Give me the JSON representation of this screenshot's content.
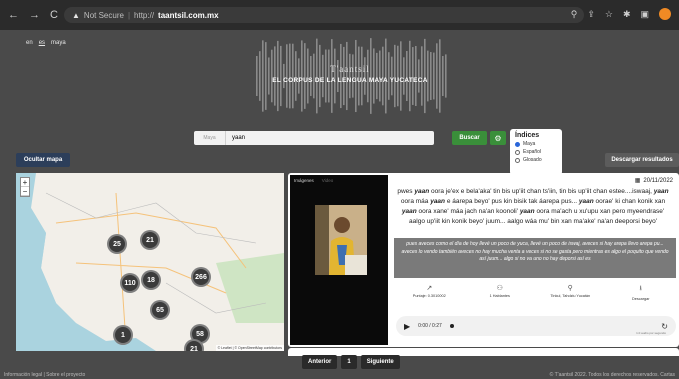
{
  "browser": {
    "security": "Not Secure",
    "url_prefix": "http://",
    "url_host": "taantsil.com.mx",
    "nav": {
      "back": "←",
      "forward": "→",
      "reload": "C"
    }
  },
  "lang": {
    "items": [
      "en",
      "es",
      "maya"
    ]
  },
  "hero": {
    "brand": "T'aantsil",
    "subtitle": "EL CORPUS DE LA LENGUA MAYA YUCATECA"
  },
  "search": {
    "prefix": "Maya",
    "query": "yaan",
    "button": "Buscar"
  },
  "indices": {
    "title": "Índices",
    "options": [
      "Maya",
      "Español",
      "Glosado"
    ],
    "selected": "Maya"
  },
  "toolbar": {
    "hide_map": "Ocultar mapa",
    "download": "Descargar resultados"
  },
  "map": {
    "clusters": [
      {
        "count": "25"
      },
      {
        "count": "21"
      },
      {
        "count": "110"
      },
      {
        "count": "18"
      },
      {
        "count": "266"
      },
      {
        "count": "65"
      },
      {
        "count": "1"
      },
      {
        "count": "58"
      },
      {
        "count": "21"
      }
    ],
    "attribution": "© Leaflet | © OpenStreetMap contributors"
  },
  "result": {
    "media_tabs": [
      "Imágenes",
      "Video"
    ],
    "date": "20/11/2022",
    "transcript_parts": [
      "pwes ",
      "yaan",
      " oora je'ex e bela'aka' tin bis up'iit chan ts'iin, tin bis up'iit chan estee....iswaaj, ",
      "yaan",
      " oora máa ",
      "yaan",
      " e áarepa beyo' pus kin bisik tak áarepa pus... ",
      "yaan",
      " oorae' ki chan konik xan ",
      "yaan",
      " oora xane' máa jach na'an koonoli' ",
      "yaan",
      " oora ma'ach u xu'upu xan pero myeendrase' aalgo up'iit kin konik beyo' juum... aalgo wáa mu' bin xan ma'ake' na'an deeporsi beyo'"
    ],
    "translation": "pues aveces como el día de hoy llevé un poco de yuca, llevé un poco de iswaj, aveces si hay arepa llevo arepa pu... aveces lo vendo también aveces no hay mucha venta a veces si no se gasta pero mientras es algo el poquito que vendo así juum... algo si no va uno no hay deporsi así es",
    "meta": [
      {
        "icon": "↗",
        "text": "Puntaje: 0.3010002"
      },
      {
        "icon": "⚇",
        "text": "1 Hablantes"
      },
      {
        "icon": "⚲",
        "text": "Tinkul, Tahdziu Yucatán"
      },
      {
        "icon": "⭳",
        "text": "Descargar"
      }
    ],
    "audio": {
      "time": "0:00 / 0:27",
      "speed": "1.0 audio por segundo"
    }
  },
  "pager": {
    "prev": "Anterior",
    "page": "1",
    "next": "Siguiente"
  },
  "footer": {
    "left": "Información legal | Sobre el proyecto",
    "right": "© T'aantsil 2022. Todos los derechos reservados. Cartas"
  }
}
